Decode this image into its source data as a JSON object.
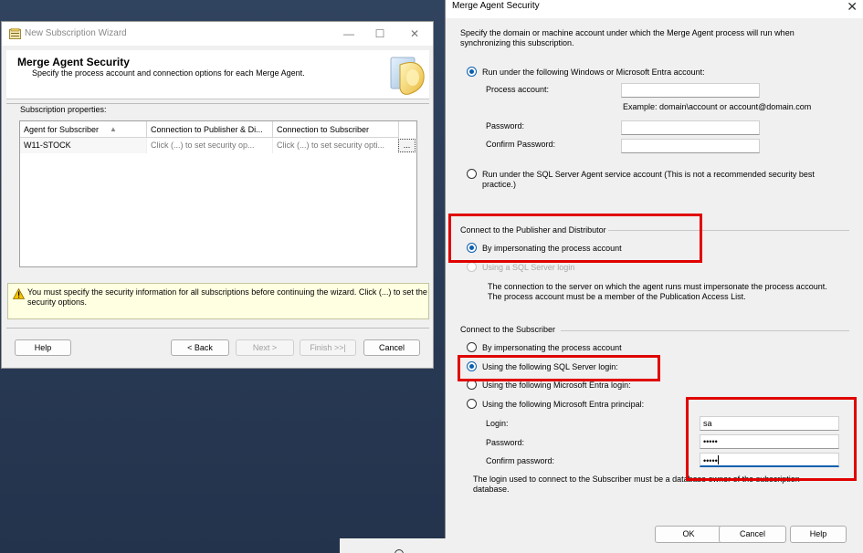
{
  "wizard": {
    "title": "New Subscription Wizard",
    "header_title": "Merge Agent Security",
    "header_subtitle": "Specify the process account and connection options for each Merge Agent.",
    "props_label": "Subscription properties:",
    "columns": [
      "Agent for Subscriber",
      "Connection to Publisher & Di...",
      "Connection to Subscriber"
    ],
    "rows": [
      {
        "agent": "W11-STOCK",
        "publisher_conn": "Click (...) to set security op...",
        "subscriber_conn": "Click (...) to set security opti...",
        "button": "..."
      }
    ],
    "warning": "You must specify the security information for all subscriptions before continuing the wizard. Click (...) to set the security options.",
    "buttons": {
      "help": "Help",
      "back": "< Back",
      "next": "Next >",
      "finish": "Finish >>|",
      "cancel": "Cancel"
    },
    "window_controls": {
      "minimize": "—",
      "maximize": "☐",
      "close": "✕"
    }
  },
  "security": {
    "title": "Merge Agent Security",
    "close": "✕",
    "intro": "Specify the domain or machine account under which the Merge Agent process will run when synchronizing this subscription.",
    "process": {
      "option_windows": "Run under the following Windows or Microsoft Entra account:",
      "process_account_label": "Process account:",
      "process_account_value": "",
      "example": "Example: domain\\account or account@domain.com",
      "password_label": "Password:",
      "password_value": "",
      "confirm_label": "Confirm Password:",
      "confirm_value": "",
      "option_agent": "Run under the SQL Server Agent service account (This is not a recommended security best practice.)"
    },
    "publisher": {
      "group": "Connect to the Publisher and Distributor",
      "option_impersonate": "By impersonating the process account",
      "option_sql": "Using a SQL Server login",
      "note": "The connection to the server on which the agent runs must impersonate the process account. The process account must be a member of the Publication Access List."
    },
    "subscriber": {
      "group": "Connect to the Subscriber",
      "option_impersonate": "By impersonating the process account",
      "option_sql": "Using the following SQL Server login:",
      "option_entra_login": "Using the following Microsoft Entra login:",
      "option_entra_principal": "Using the following Microsoft Entra principal:",
      "login_label": "Login:",
      "login_value": "sa",
      "password_label": "Password:",
      "password_value": "•••••",
      "confirm_label": "Confirm password:",
      "confirm_value": "•••••",
      "note": "The login used to connect to the Subscriber must be a database owner of the subscription database."
    },
    "buttons": {
      "ok": "OK",
      "cancel": "Cancel",
      "help": "Help"
    }
  },
  "colors": {
    "highlight_red": "#e00000",
    "radio_blue": "#0a5fb0",
    "desktop": "#2b3a55"
  }
}
